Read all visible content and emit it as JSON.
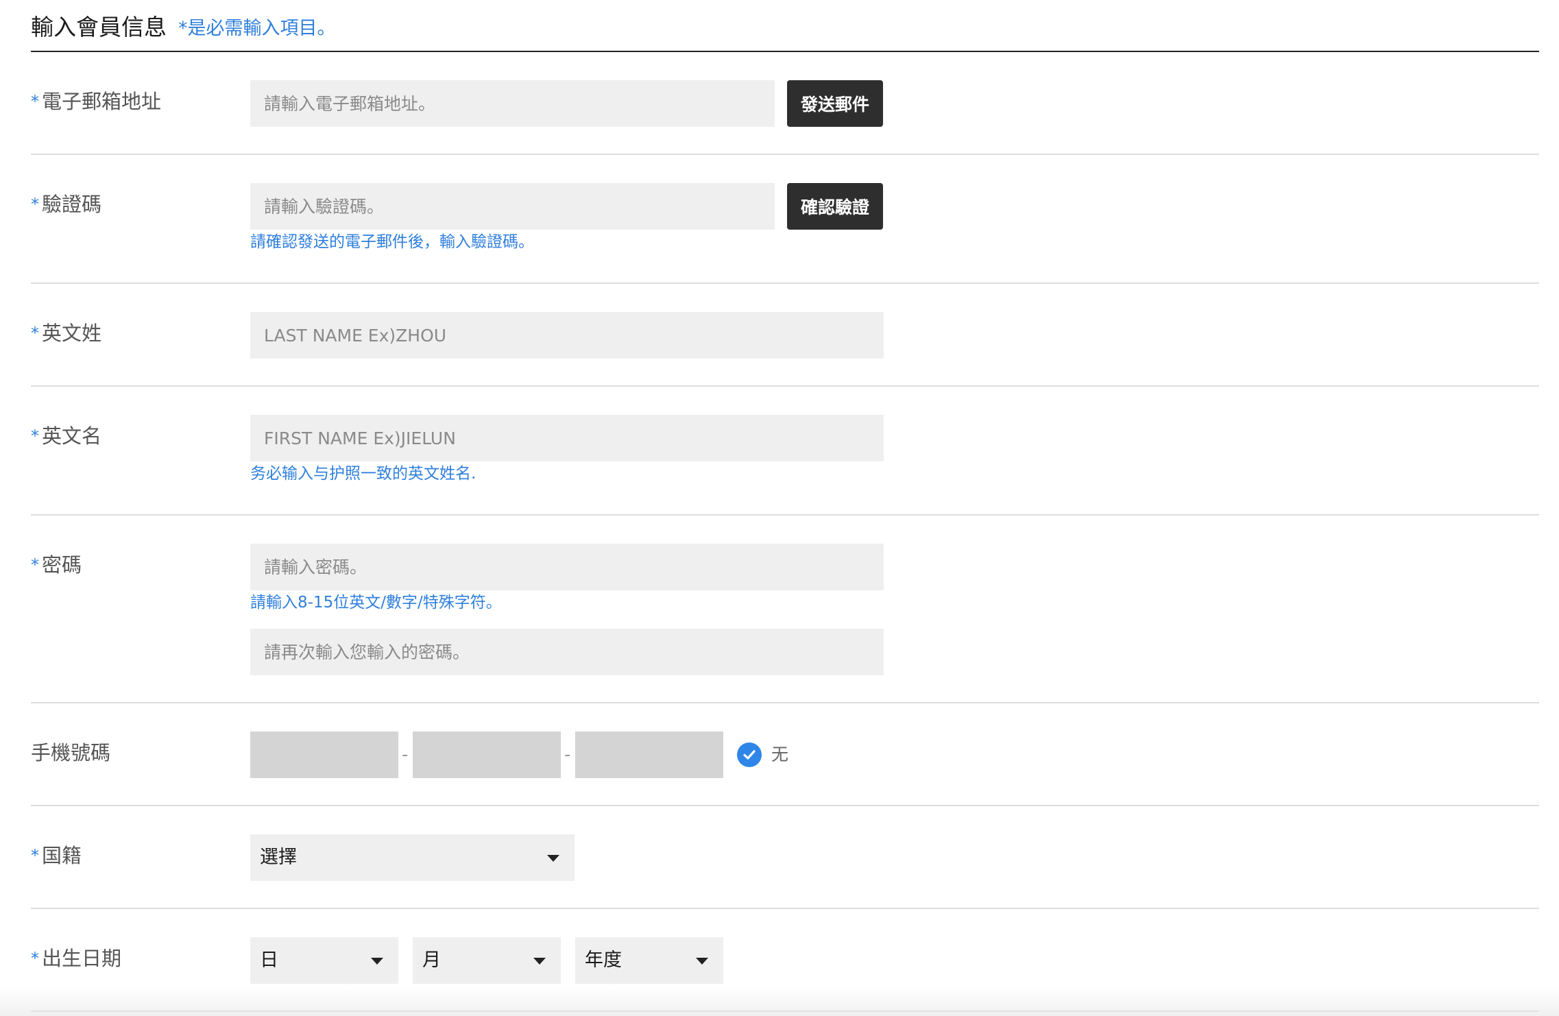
{
  "header": {
    "title": "輸入會員信息",
    "required_note": "*是必需輸入項目。"
  },
  "required_mark": "*",
  "email": {
    "label": "電子郵箱地址",
    "placeholder": "請輸入電子郵箱地址。",
    "button": "發送郵件"
  },
  "verification": {
    "label": "驗證碼",
    "placeholder": "請輸入驗證碼。",
    "button": "確認驗證",
    "hint": "請確認發送的電子郵件後，輸入驗證碼。"
  },
  "last_name": {
    "label": "英文姓",
    "placeholder": "LAST NAME Ex)ZHOU"
  },
  "first_name": {
    "label": "英文名",
    "placeholder": "FIRST NAME Ex)JIELUN",
    "hint": "务必输入与护照一致的英文姓名."
  },
  "password": {
    "label": "密碼",
    "placeholder": "請輸入密碼。",
    "hint": "請輸入8-15位英文/數字/特殊字符。",
    "confirm_placeholder": "請再次輸入您輸入的密碼。"
  },
  "phone": {
    "label": "手機號碼",
    "separator": "-",
    "none_label": "无",
    "none_checked": true
  },
  "nationality": {
    "label": "国籍",
    "selected": "選擇"
  },
  "birthdate": {
    "label": "出生日期",
    "day": "日",
    "month": "月",
    "year": "年度"
  },
  "colors": {
    "accent": "#2f7fdc",
    "button_bg": "#2e2e2e",
    "field_bg": "#efefef",
    "phone_field_bg": "#d4d4d4"
  }
}
